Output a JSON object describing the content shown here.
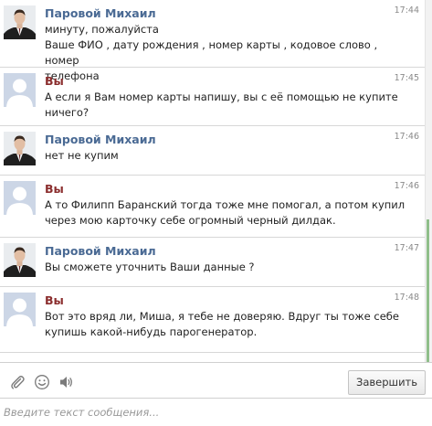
{
  "messages": [
    {
      "sender": "Паровой Михаил",
      "time": "17:44",
      "text": "минуту, пожалуйста\nВаше ФИО , дату рождения , номер карты , кодовое слово , номер телефона"
    },
    {
      "sender": "Вы",
      "time": "17:45",
      "text": "А если я Вам номер карты напишу, вы с её помощью не купите ничего?"
    },
    {
      "sender": "Паровой Михаил",
      "time": "17:46",
      "text": "нет не купим"
    },
    {
      "sender": "Вы",
      "time": "17:46",
      "text": "А то Филипп Баранский тогда тоже мне помогал, а потом купил через мою карточку себе огромный черный дилдак."
    },
    {
      "sender": "Паровой Михаил",
      "time": "17:47",
      "text": "Вы сможете уточнить Ваши данные ?"
    },
    {
      "sender": "Вы",
      "time": "17:48",
      "text": "Вот это вряд ли, Миша, я тебе не доверяю. Вдруг ты тоже себе купишь какой-нибудь парогенератор."
    }
  ],
  "toolbar": {
    "attach_icon": "paperclip-icon",
    "emoji_icon": "smiley-icon",
    "sound_icon": "speaker-icon",
    "finish_label": "Завершить"
  },
  "composer": {
    "placeholder": "Введите текст сообщения..."
  },
  "colors": {
    "agent_name": "#4a6a94",
    "user_name": "#8b2e2e",
    "scroll_thumb": "#8fbe8a"
  }
}
